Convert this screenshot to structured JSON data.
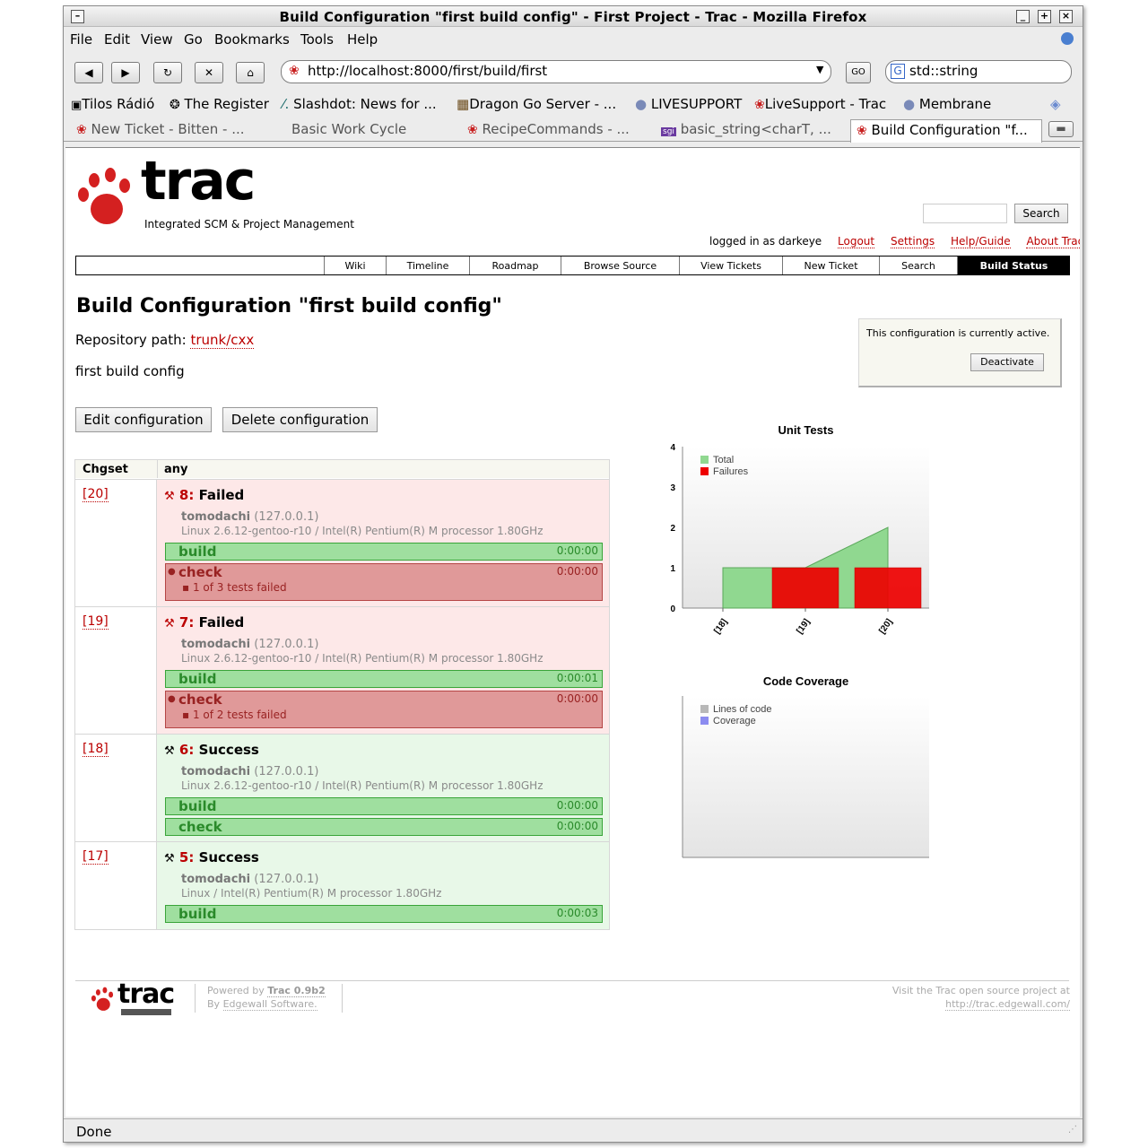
{
  "window": {
    "title": "Build Configuration \"first build config\" - First Project - Trac - Mozilla Firefox"
  },
  "menu": {
    "items": [
      {
        "label": "File"
      },
      {
        "label": "Edit"
      },
      {
        "label": "View"
      },
      {
        "label": "Go"
      },
      {
        "label": "Bookmarks"
      },
      {
        "label": "Tools"
      },
      {
        "label": "Help"
      }
    ]
  },
  "nav": {
    "url": "http://localhost:8000/first/build/first",
    "go_label": "GO",
    "search_text": "std::string"
  },
  "bookmarks": [
    {
      "label": "Tilos Rádió"
    },
    {
      "label": "The Register"
    },
    {
      "label": "Slashdot: News for ..."
    },
    {
      "label": "Dragon Go Server - ..."
    },
    {
      "label": "LIVESUPPORT"
    },
    {
      "label": "LiveSupport - Trac"
    },
    {
      "label": "Membrane"
    }
  ],
  "tabs": [
    {
      "label": "New Ticket - Bitten - ..."
    },
    {
      "label": "Basic Work Cycle"
    },
    {
      "label": "RecipeCommands - ..."
    },
    {
      "label": "basic_string<charT, ..."
    },
    {
      "label": "Build Configuration \"f..."
    }
  ],
  "page": {
    "logo_text": "trac",
    "logo_sub": "Integrated SCM & Project Management",
    "search_button": "Search",
    "meta": {
      "logged_in": "logged in as darkeye",
      "logout": "Logout",
      "settings": "Settings",
      "help": "Help/Guide",
      "about": "About Trac"
    },
    "mainnav": [
      {
        "label": "Wiki"
      },
      {
        "label": "Timeline"
      },
      {
        "label": "Roadmap"
      },
      {
        "label": "Browse Source"
      },
      {
        "label": "View Tickets"
      },
      {
        "label": "New Ticket"
      },
      {
        "label": "Search"
      },
      {
        "label": "Build Status"
      }
    ],
    "heading": "Build Configuration \"first build config\"",
    "repo_label": "Repository path:",
    "repo_path": "trunk/cxx",
    "description": "first build config",
    "edit_button": "Edit configuration",
    "delete_button": "Delete configuration",
    "active_box": {
      "text": "This configuration is currently active.",
      "button": "Deactivate"
    },
    "table": {
      "col1": "Chgset",
      "col2": "any",
      "rows": [
        {
          "chgset": "[20]",
          "build_num": "8:",
          "status": "Failed",
          "slave": "tomodachi",
          "ip": "(127.0.0.1)",
          "platform": "Linux 2.6.12-gentoo-r10 / Intel(R) Pentium(R) M processor 1.80GHz",
          "steps": [
            {
              "name": "build",
              "time": "0:00:00",
              "ok": true
            },
            {
              "name": "check",
              "time": "0:00:00",
              "ok": false,
              "error": "1 of 3 tests failed"
            }
          ]
        },
        {
          "chgset": "[19]",
          "build_num": "7:",
          "status": "Failed",
          "slave": "tomodachi",
          "ip": "(127.0.0.1)",
          "platform": "Linux 2.6.12-gentoo-r10 / Intel(R) Pentium(R) M processor 1.80GHz",
          "steps": [
            {
              "name": "build",
              "time": "0:00:01",
              "ok": true
            },
            {
              "name": "check",
              "time": "0:00:00",
              "ok": false,
              "error": "1 of 2 tests failed"
            }
          ]
        },
        {
          "chgset": "[18]",
          "build_num": "6:",
          "status": "Success",
          "slave": "tomodachi",
          "ip": "(127.0.0.1)",
          "platform": "Linux 2.6.12-gentoo-r10 / Intel(R) Pentium(R) M processor 1.80GHz",
          "steps": [
            {
              "name": "build",
              "time": "0:00:00",
              "ok": true
            },
            {
              "name": "check",
              "time": "0:00:00",
              "ok": true
            }
          ]
        },
        {
          "chgset": "[17]",
          "build_num": "5:",
          "status": "Success",
          "slave": "tomodachi",
          "ip": "(127.0.0.1)",
          "platform": "Linux / Intel(R) Pentium(R) M processor 1.80GHz",
          "steps": [
            {
              "name": "build",
              "time": "0:00:03",
              "ok": true
            }
          ]
        }
      ]
    },
    "footer": {
      "powered": "Powered by",
      "trac_version": "Trac 0.9b2",
      "by": "By",
      "edgewall": "Edgewall Software.",
      "visit": "Visit the Trac open source project at",
      "url": "http://trac.edgewall.com/"
    }
  },
  "status": "Done",
  "chart_data": [
    {
      "type": "area",
      "title": "Unit Tests",
      "categories": [
        "[18]",
        "[19]",
        "[20]"
      ],
      "ylim": [
        0,
        4
      ],
      "yticks": [
        0,
        1,
        2,
        3,
        4
      ],
      "series": [
        {
          "name": "Total",
          "values": [
            1,
            1,
            2
          ],
          "color": "#90d890"
        },
        {
          "name": "Failures",
          "values": [
            0,
            1,
            1
          ],
          "color": "#ee0000"
        }
      ],
      "legend": "top-left"
    },
    {
      "type": "area",
      "title": "Code Coverage",
      "categories": [],
      "series": [
        {
          "name": "Lines of code",
          "values": [],
          "color": "#b8b8b8"
        },
        {
          "name": "Coverage",
          "values": [],
          "color": "#8c8cf0"
        }
      ],
      "legend": "top-left"
    }
  ]
}
